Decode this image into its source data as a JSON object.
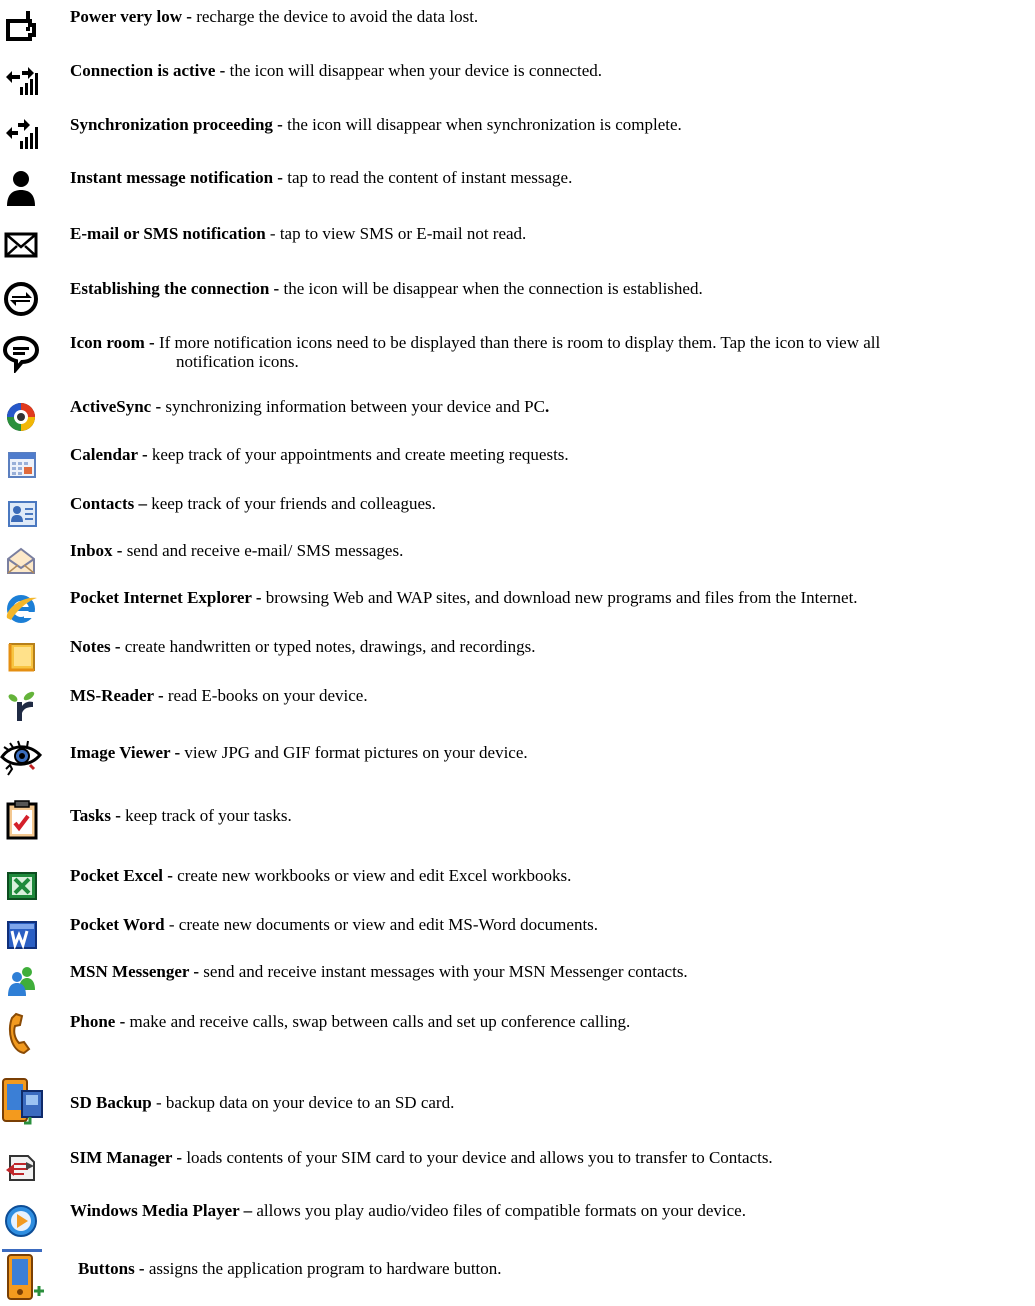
{
  "entries": [
    {
      "icon": "battery-low-icon",
      "title": "Power very low -",
      "desc": " recharge the device to avoid the data lost."
    },
    {
      "icon": "connection-active-icon",
      "title": "Connection is active -",
      "desc": " the icon will disappear when your device is connected."
    },
    {
      "icon": "sync-proceeding-icon",
      "title": "Synchronization proceeding -",
      "desc": " the icon will disappear when synchronization is complete."
    },
    {
      "icon": "instant-message-icon",
      "title": "Instant message notification -",
      "desc": " tap to read the content of instant message."
    },
    {
      "icon": "envelope-icon",
      "title": "E-mail or SMS notification",
      "desc": " - tap to view SMS or E-mail not read."
    },
    {
      "icon": "establishing-connection-icon",
      "title": "Establishing the connection -",
      "desc": " the icon will be disappear when the connection is established."
    },
    {
      "icon": "speech-bubble-icon",
      "title": "Icon room -",
      "desc": " If more notification icons need to be displayed than there is room to display them. Tap the icon to view all",
      "desc2": "notification icons."
    },
    {
      "icon": "activesync-icon",
      "title": "ActiveSync -",
      "desc": " synchronizing information between your device and PC",
      "desc_tail": "."
    },
    {
      "icon": "calendar-icon",
      "title": "Calendar -",
      "desc": " keep track of your appointments and create meeting requests."
    },
    {
      "icon": "contacts-icon",
      "title": "Contacts –",
      "desc": " keep track of your friends and colleagues."
    },
    {
      "icon": "inbox-icon",
      "title": "Inbox -",
      "desc": " send and receive e-mail/ SMS messages."
    },
    {
      "icon": "internet-explorer-icon",
      "title": "Pocket Internet Explorer -",
      "desc": " browsing Web and WAP sites, and download new programs and files from the Internet."
    },
    {
      "icon": "notes-icon",
      "title": "Notes -",
      "desc": " create handwritten or typed notes, drawings, and recordings."
    },
    {
      "icon": "ms-reader-icon",
      "title": "MS-Reader -",
      "desc": " read E-books on your device."
    },
    {
      "icon": "image-viewer-eye-icon",
      "title": "Image Viewer -",
      "desc": " view JPG and GIF format pictures on your device."
    },
    {
      "icon": "tasks-clipboard-icon",
      "title": "Tasks -",
      "desc": " keep track of your tasks."
    },
    {
      "icon": "pocket-excel-icon",
      "title": "Pocket Excel -",
      "desc": " create new workbooks or view and edit Excel workbooks."
    },
    {
      "icon": "pocket-word-icon",
      "title": "Pocket Word",
      "desc": " - create new documents or view and edit MS-Word documents."
    },
    {
      "icon": "msn-messenger-icon",
      "title": "MSN Messenger -",
      "desc": " send and receive instant messages with your MSN Messenger contacts."
    },
    {
      "icon": "phone-handset-icon",
      "title": "Phone -",
      "desc": " make and receive calls, swap between calls and set up conference calling."
    },
    {
      "icon": "sd-backup-icon",
      "title": "SD Backup",
      "desc": " - backup data on your device to an SD card."
    },
    {
      "icon": "sim-manager-icon",
      "title": "SIM Manager -",
      "desc": " loads contents of your SIM card to your device and allows you to transfer to Contacts."
    },
    {
      "icon": "media-player-icon",
      "title": "Windows Media Player –",
      "desc": " allows you play audio/video files of compatible formats on your device."
    },
    {
      "icon": "buttons-device-icon",
      "title": "Buttons -",
      "desc": " assigns the application program to hardware button."
    }
  ]
}
